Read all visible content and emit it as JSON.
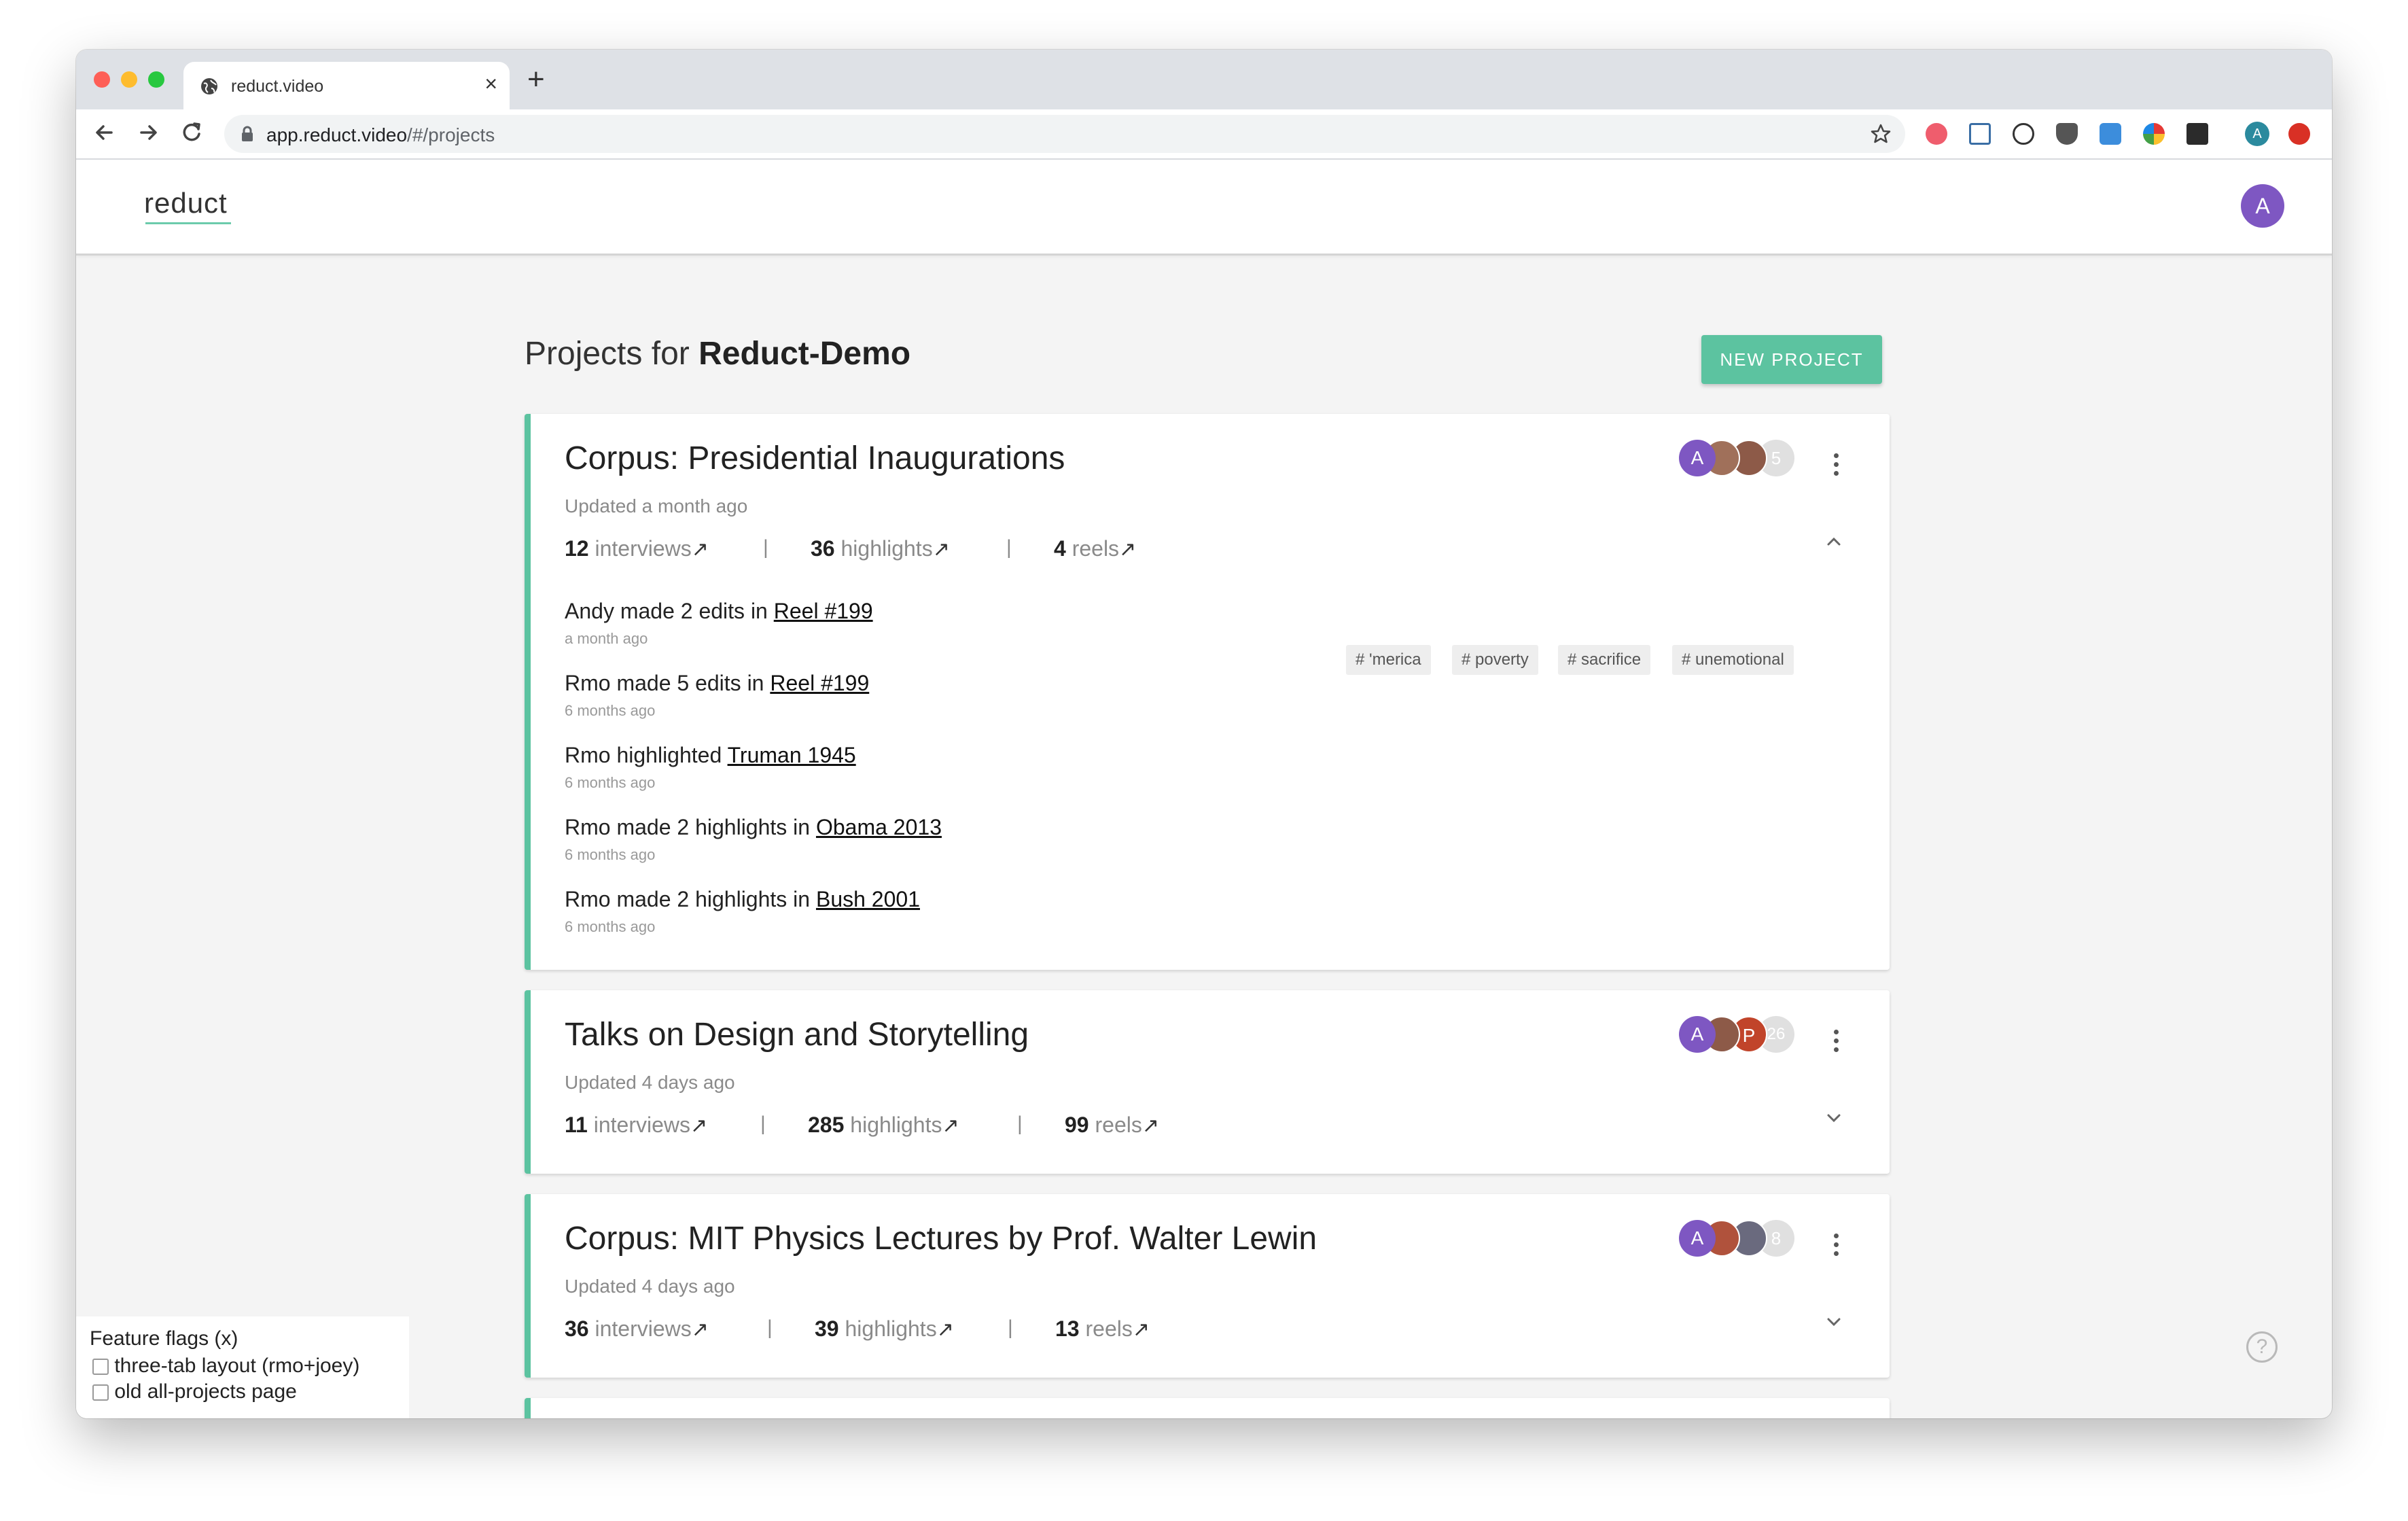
{
  "browser": {
    "tab_title": "reduct.video",
    "tab_close": "×",
    "new_tab": "+",
    "url_host": "app.reduct.video",
    "url_path": "/#/projects",
    "profile_initial": "A"
  },
  "app": {
    "logo": "reduct",
    "user_initial": "A"
  },
  "page": {
    "title_prefix": "Projects for ",
    "org_name": "Reduct-Demo",
    "new_project_label": "NEW PROJECT"
  },
  "projects": [
    {
      "title": "Corpus: Presidential Inaugurations",
      "updated": "Updated a month ago",
      "interviews_count": "12",
      "interviews_label": "interviews",
      "highlights_count": "36",
      "highlights_label": "highlights",
      "reels_count": "4",
      "reels_label": "reels",
      "avatar_initial": "A",
      "member_count": "5",
      "expanded": true,
      "activity": [
        {
          "text": "Andy made 2 edits in ",
          "link": "Reel #199",
          "time": "a month ago"
        },
        {
          "text": "Rmo made 5 edits in ",
          "link": "Reel #199",
          "time": "6 months ago"
        },
        {
          "text": "Rmo highlighted ",
          "link": "Truman 1945",
          "time": "6 months ago"
        },
        {
          "text": "Rmo made 2 highlights in ",
          "link": "Obama 2013",
          "time": "6 months ago"
        },
        {
          "text": "Rmo made 2 highlights in ",
          "link": "Bush 2001",
          "time": "6 months ago"
        }
      ],
      "tags": [
        "# 'merica",
        "# poverty",
        "# sacrifice",
        "# unemotional"
      ]
    },
    {
      "title": "Talks on Design and Storytelling",
      "updated": "Updated 4 days ago",
      "interviews_count": "11",
      "interviews_label": "interviews",
      "highlights_count": "285",
      "highlights_label": "highlights",
      "reels_count": "99",
      "reels_label": "reels",
      "avatar_initial": "A",
      "avatar_initial_2": "P",
      "member_count": "26",
      "expanded": false
    },
    {
      "title": "Corpus: MIT Physics Lectures by Prof. Walter Lewin",
      "updated": "Updated 4 days ago",
      "interviews_count": "36",
      "interviews_label": "interviews",
      "highlights_count": "39",
      "highlights_label": "highlights",
      "reels_count": "13",
      "reels_label": "reels",
      "avatar_initial": "A",
      "member_count": "8",
      "expanded": false
    }
  ],
  "stat_separator": "|",
  "arrow_glyph": "↗",
  "feature_flags": {
    "title": "Feature flags (x)",
    "items": [
      "three-tab layout (rmo+joey)",
      "old all-projects page"
    ]
  },
  "help_glyph": "?",
  "colors": {
    "accent": "#5cc3a0",
    "avatar_purple": "#7e57c2",
    "background": "#f4f4f4"
  }
}
